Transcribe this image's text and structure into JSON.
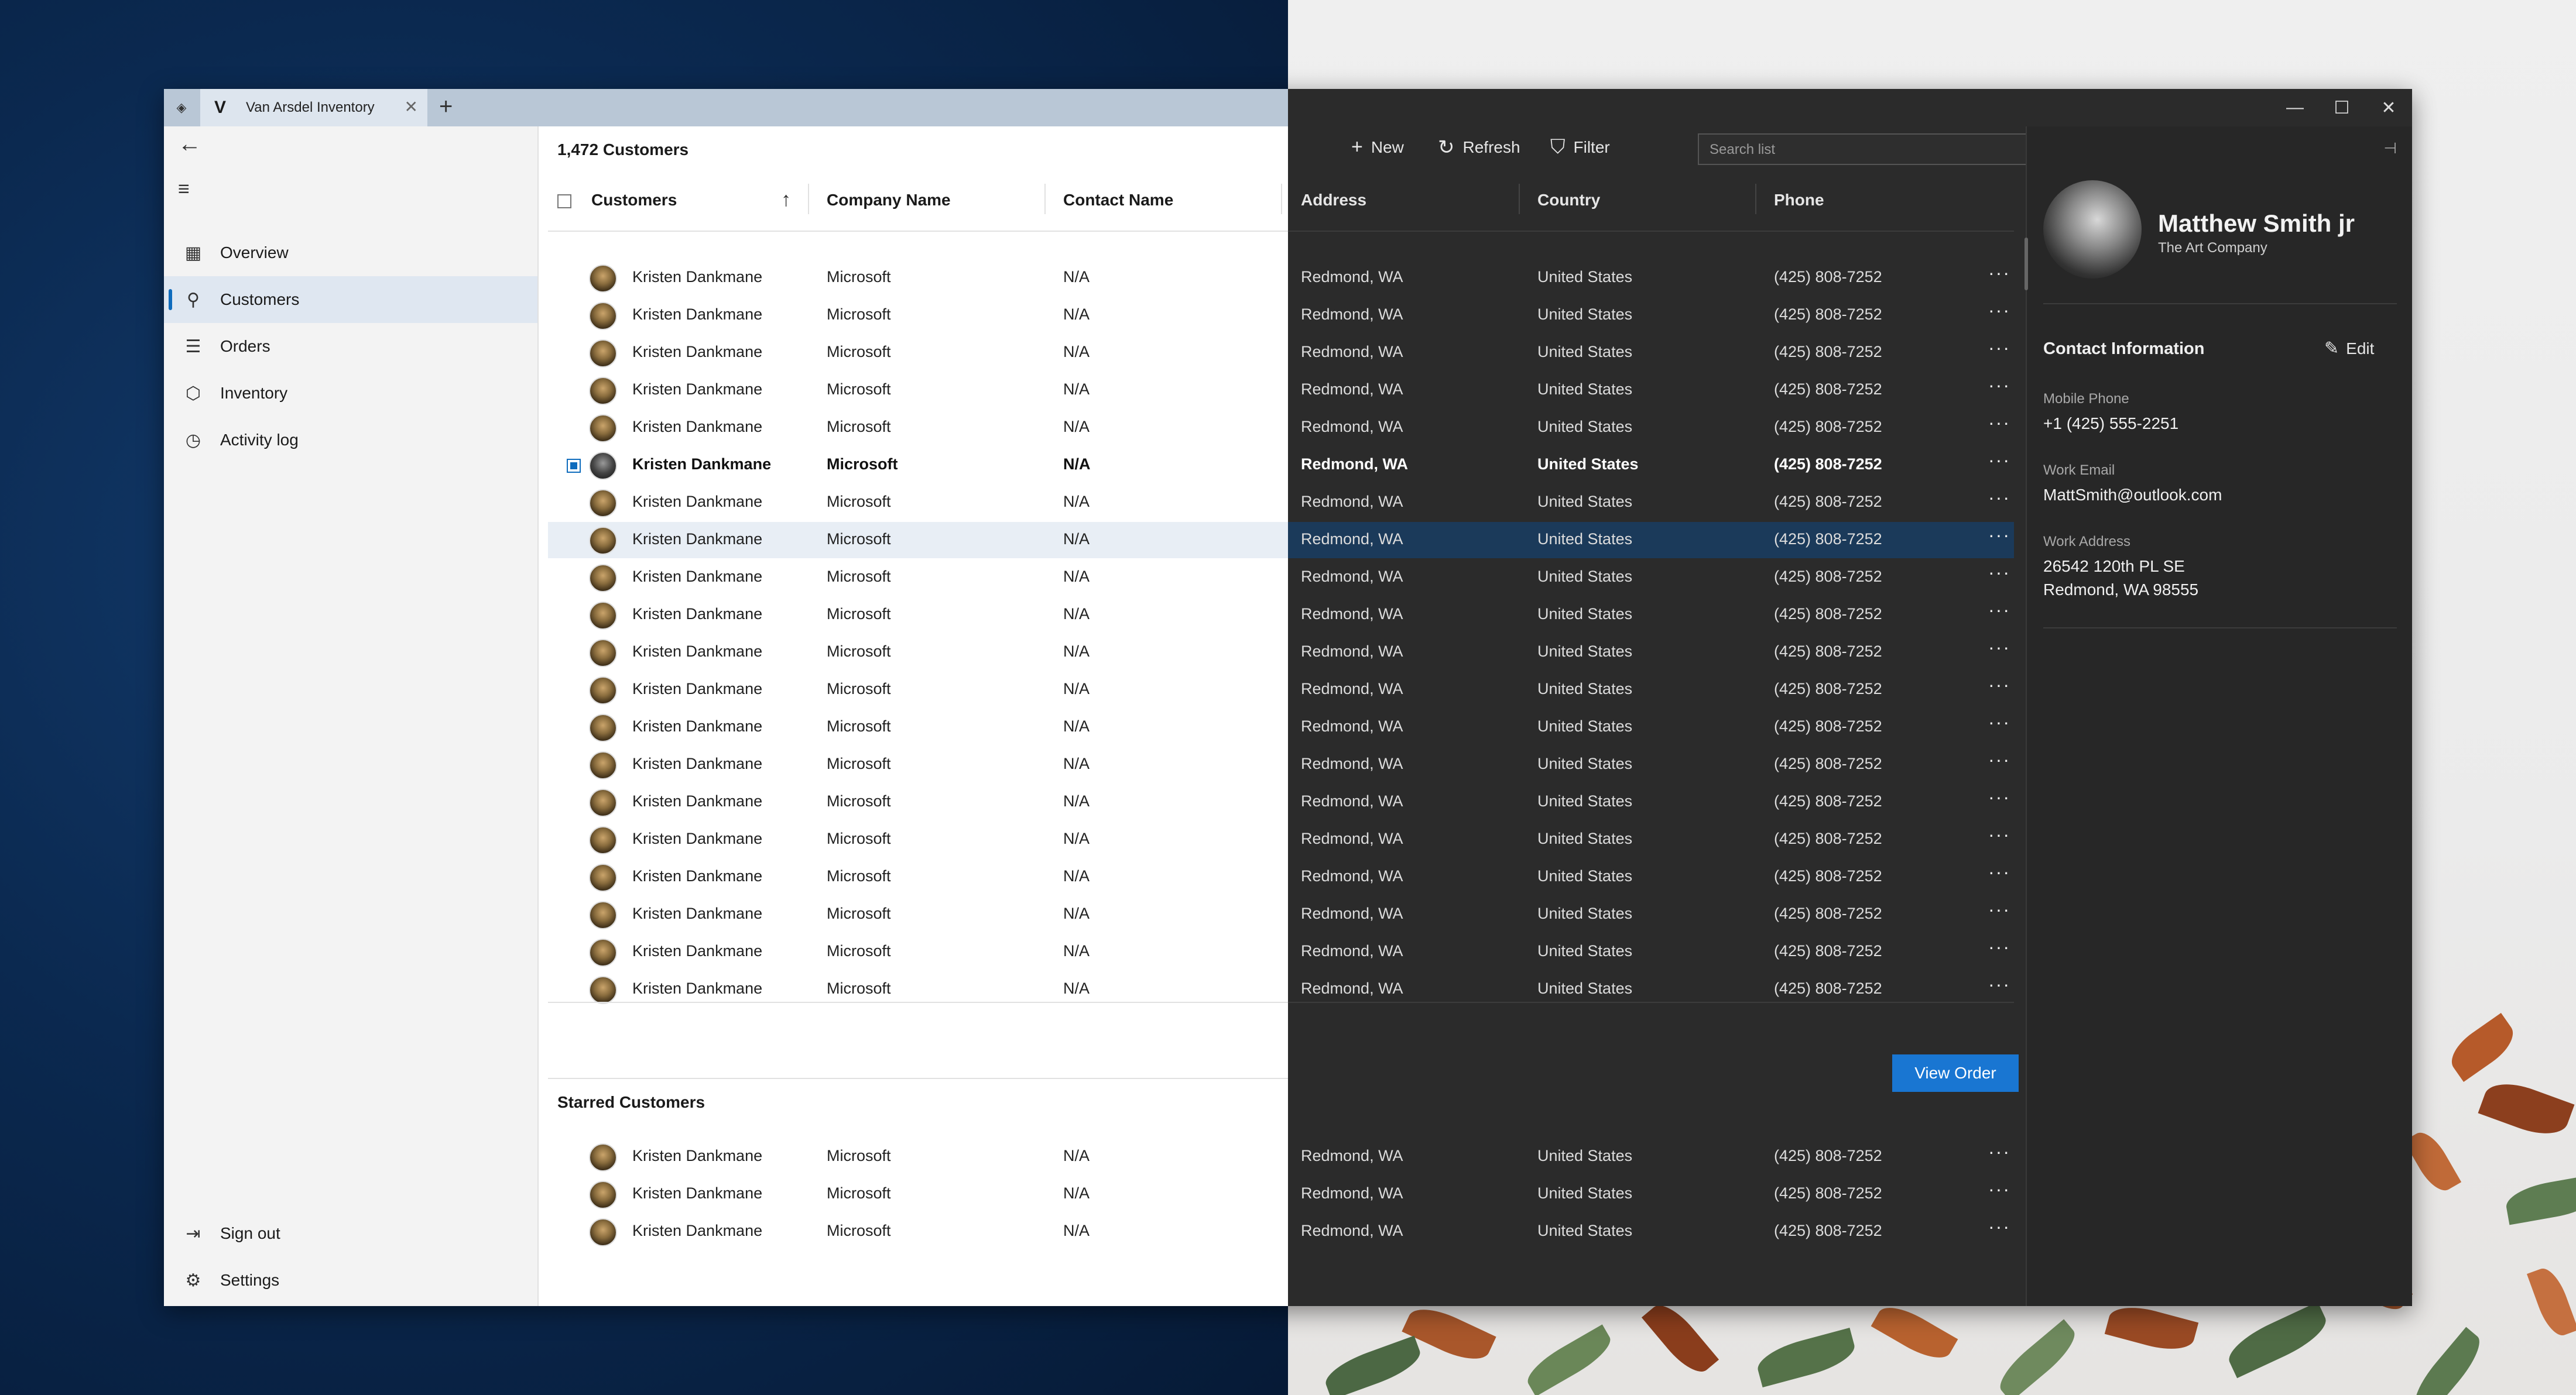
{
  "tab": {
    "title": "Van Arsdel Inventory",
    "logo": "V",
    "close": "✕",
    "new": "+"
  },
  "window_controls": {
    "minimize": "—",
    "maximize": "☐",
    "close": "✕"
  },
  "nav": {
    "items": [
      {
        "label": "Overview",
        "icon": "grid-icon",
        "glyph": "▦"
      },
      {
        "label": "Customers",
        "icon": "person-icon",
        "glyph": "⚲"
      },
      {
        "label": "Orders",
        "icon": "list-icon",
        "glyph": "☰"
      },
      {
        "label": "Inventory",
        "icon": "box-icon",
        "glyph": "⬡"
      },
      {
        "label": "Activity log",
        "icon": "clock-icon",
        "glyph": "◷"
      }
    ],
    "bottom": [
      {
        "label": "Sign out",
        "icon": "sign-out-icon",
        "glyph": "⇥"
      },
      {
        "label": "Settings",
        "icon": "gear-icon",
        "glyph": "⚙"
      }
    ],
    "selected": "Customers"
  },
  "list": {
    "count_label": "1,472 Customers",
    "columns": {
      "customers": "Customers",
      "company": "Company Name",
      "contact": "Contact Name",
      "address": "Address",
      "country": "Country",
      "phone": "Phone"
    },
    "sort_indicator": "↑",
    "rows": [
      [
        "Kristen Dankmane",
        "Microsoft",
        "N/A",
        "Redmond, WA",
        "United States",
        "(425) 808-7252"
      ],
      [
        "Kristen Dankmane",
        "Microsoft",
        "N/A",
        "Redmond, WA",
        "United States",
        "(425) 808-7252"
      ],
      [
        "Kristen Dankmane",
        "Microsoft",
        "N/A",
        "Redmond, WA",
        "United States",
        "(425) 808-7252"
      ],
      [
        "Kristen Dankmane",
        "Microsoft",
        "N/A",
        "Redmond, WA",
        "United States",
        "(425) 808-7252"
      ],
      [
        "Kristen Dankmane",
        "Microsoft",
        "N/A",
        "Redmond, WA",
        "United States",
        "(425) 808-7252"
      ],
      [
        "Kristen Dankmane",
        "Microsoft",
        "N/A",
        "Redmond, WA",
        "United States",
        "(425) 808-7252"
      ],
      [
        "Kristen Dankmane",
        "Microsoft",
        "N/A",
        "Redmond, WA",
        "United States",
        "(425) 808-7252"
      ],
      [
        "Kristen Dankmane",
        "Microsoft",
        "N/A",
        "Redmond, WA",
        "United States",
        "(425) 808-7252"
      ],
      [
        "Kristen Dankmane",
        "Microsoft",
        "N/A",
        "Redmond, WA",
        "United States",
        "(425) 808-7252"
      ],
      [
        "Kristen Dankmane",
        "Microsoft",
        "N/A",
        "Redmond, WA",
        "United States",
        "(425) 808-7252"
      ],
      [
        "Kristen Dankmane",
        "Microsoft",
        "N/A",
        "Redmond, WA",
        "United States",
        "(425) 808-7252"
      ],
      [
        "Kristen Dankmane",
        "Microsoft",
        "N/A",
        "Redmond, WA",
        "United States",
        "(425) 808-7252"
      ],
      [
        "Kristen Dankmane",
        "Microsoft",
        "N/A",
        "Redmond, WA",
        "United States",
        "(425) 808-7252"
      ],
      [
        "Kristen Dankmane",
        "Microsoft",
        "N/A",
        "Redmond, WA",
        "United States",
        "(425) 808-7252"
      ],
      [
        "Kristen Dankmane",
        "Microsoft",
        "N/A",
        "Redmond, WA",
        "United States",
        "(425) 808-7252"
      ],
      [
        "Kristen Dankmane",
        "Microsoft",
        "N/A",
        "Redmond, WA",
        "United States",
        "(425) 808-7252"
      ],
      [
        "Kristen Dankmane",
        "Microsoft",
        "N/A",
        "Redmond, WA",
        "United States",
        "(425) 808-7252"
      ],
      [
        "Kristen Dankmane",
        "Microsoft",
        "N/A",
        "Redmond, WA",
        "United States",
        "(425) 808-7252"
      ],
      [
        "Kristen Dankmane",
        "Microsoft",
        "N/A",
        "Redmond, WA",
        "United States",
        "(425) 808-7252"
      ],
      [
        "Kristen Dankmane",
        "Microsoft",
        "N/A",
        "Redmond, WA",
        "United States",
        "(425) 808-7252"
      ]
    ],
    "selected_row_index": 5,
    "more_glyph": "···"
  },
  "toolbar": {
    "new_label": "New",
    "refresh_label": "Refresh",
    "filter_label": "Filter",
    "search_placeholder": "Search list"
  },
  "view_order_label": "View Order",
  "starred": {
    "title": "Starred Customers",
    "rows": [
      [
        "Kristen Dankmane",
        "Microsoft",
        "N/A",
        "Redmond, WA",
        "United States",
        "(425) 808-7252"
      ],
      [
        "Kristen Dankmane",
        "Microsoft",
        "N/A",
        "Redmond, WA",
        "United States",
        "(425) 808-7252"
      ],
      [
        "Kristen Dankmane",
        "Microsoft",
        "N/A",
        "Redmond, WA",
        "United States",
        "(425) 808-7252"
      ]
    ]
  },
  "detail": {
    "name": "Matthew Smith jr",
    "company": "The Art Company",
    "section_title": "Contact Information",
    "edit_label": "Edit",
    "fields": [
      {
        "label": "Mobile Phone",
        "value": "+1 (425) 555-2251"
      },
      {
        "label": "Work Email",
        "value": "MattSmith@outlook.com"
      },
      {
        "label": "Work Address",
        "value": "26542 120th PL SE",
        "value2": "Redmond, WA 98555"
      }
    ]
  },
  "colors": {
    "accent": "#1976d2",
    "dark_bg": "#2b2b2b",
    "light_bg": "#ffffff",
    "nav_bg": "#f3f3f3",
    "selected_row_dark": "#1b3a5a"
  }
}
